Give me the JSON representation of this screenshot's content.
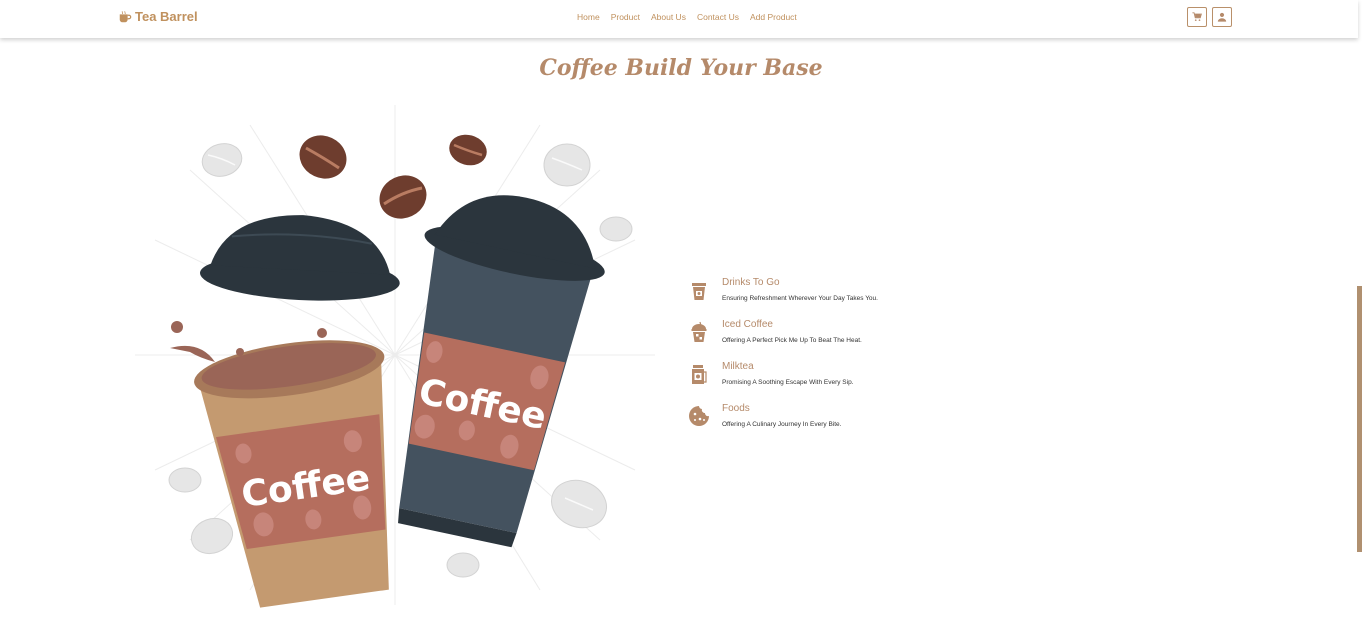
{
  "brand": {
    "name": "Tea Barrel",
    "icon": "coffee-cup-icon",
    "color": "#c0915e"
  },
  "nav": {
    "links": [
      "Home",
      "Product",
      "About Us",
      "Contact Us",
      "Add Product"
    ],
    "cart_icon": "cart-icon",
    "user_icon": "user-icon"
  },
  "hero": {
    "title": "Coffee Build Your Base",
    "cup_label_left": "Coffee",
    "cup_label_right": "Coffee"
  },
  "features": [
    {
      "title": "Drinks To Go",
      "desc": "Ensuring Refreshment Wherever Your Day Takes You.",
      "icon": "to-go-cup-icon"
    },
    {
      "title": "Iced Coffee",
      "desc": "Offering A Perfect Pick Me Up To Beat The Heat.",
      "icon": "iced-coffee-icon"
    },
    {
      "title": "Milktea",
      "desc": "Promising A Soothing Escape With Every Sip.",
      "icon": "milktea-icon"
    },
    {
      "title": "Foods",
      "desc": "Offering A Culinary Journey In Every Bite.",
      "icon": "cookie-icon"
    }
  ],
  "colors": {
    "accent": "#b58a6a",
    "cup_tan": "#c49a70",
    "cup_sleeve": "#b56e5e",
    "cup_dark": "#44525f",
    "lid": "#2b353d"
  }
}
